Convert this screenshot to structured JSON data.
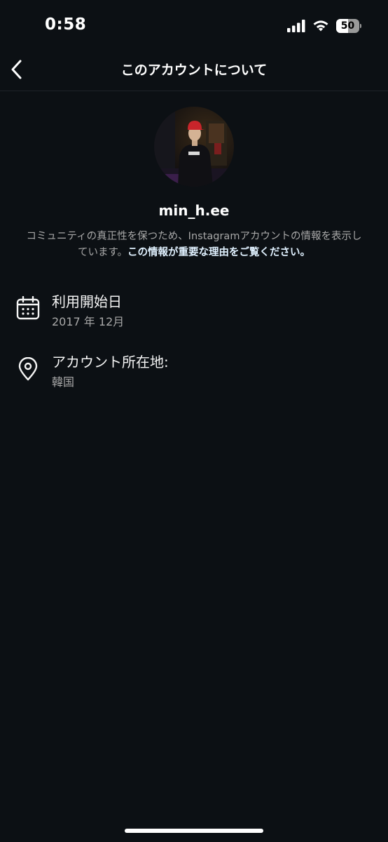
{
  "status_bar": {
    "time": "0:58",
    "battery_level": "50",
    "battery_fraction": 0.5,
    "icons": [
      "cellular-signal-icon",
      "wifi-icon",
      "battery-icon"
    ]
  },
  "nav": {
    "back_icon": "chevron-left-icon",
    "title": "このアカウントについて"
  },
  "profile": {
    "username": "min_h.ee",
    "description_text": "コミュニティの真正性を保つため、Instagramアカウントの情報を表示しています。",
    "description_link": "この情報が重要な理由をご覧ください。"
  },
  "info_rows": [
    {
      "icon": "calendar-icon",
      "label": "利用開始日",
      "value": "2017 年 12月"
    },
    {
      "icon": "location-pin-icon",
      "label": "アカウント所在地:",
      "value": "韓国"
    }
  ],
  "colors": {
    "background": "#0c1014",
    "primary_text": "#f5f5f5",
    "secondary_text": "#a8a8a8",
    "link_text": "#e0f1ff"
  }
}
